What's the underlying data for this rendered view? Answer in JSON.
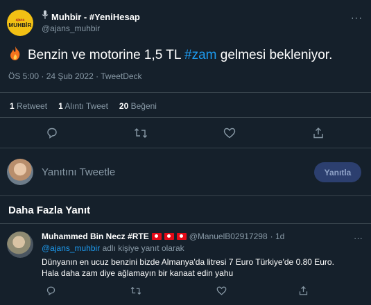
{
  "tweet": {
    "avatar_text": [
      "ajans",
      "MUHBİR"
    ],
    "author_name": "Muhbir - #YeniHesap",
    "author_handle": "@ajans_muhbir",
    "more": "···",
    "text_before": "Benzin ve motorine 1,5 TL ",
    "hashtag": "#zam",
    "text_after": " gelmesi bekleniyor.",
    "timestamp": "ÖS 5:00 · 24 Şub 2022 · TweetDeck"
  },
  "stats": [
    {
      "count": "1",
      "label": "Retweet"
    },
    {
      "count": "1",
      "label": "Alıntı Tweet"
    },
    {
      "count": "20",
      "label": "Beğeni"
    }
  ],
  "compose": {
    "placeholder": "Yanıtını Tweetle",
    "button": "Yanıtla"
  },
  "section_title": "Daha Fazla Yanıt",
  "reply": {
    "name": "Muhammed Bin Necz #RTE",
    "handle": "@ManuelB02917298",
    "time": "· 1d",
    "more": "···",
    "replying_mention": "@ajans_muhbir",
    "replying_suffix": " adlı kişiye yanıt olarak",
    "text_line1": "Dünyanın en ucuz benzini bizde Almanya'da litresi 7 Euro Türkiye'de 0.80 Euro.",
    "text_line2": "Hala daha zam diye ağlamayın bir kanaat edin yahu"
  },
  "colors": {
    "background": "#15202b",
    "accent": "#1d9bf0",
    "muted": "#8899a6",
    "divider": "#38444d"
  }
}
